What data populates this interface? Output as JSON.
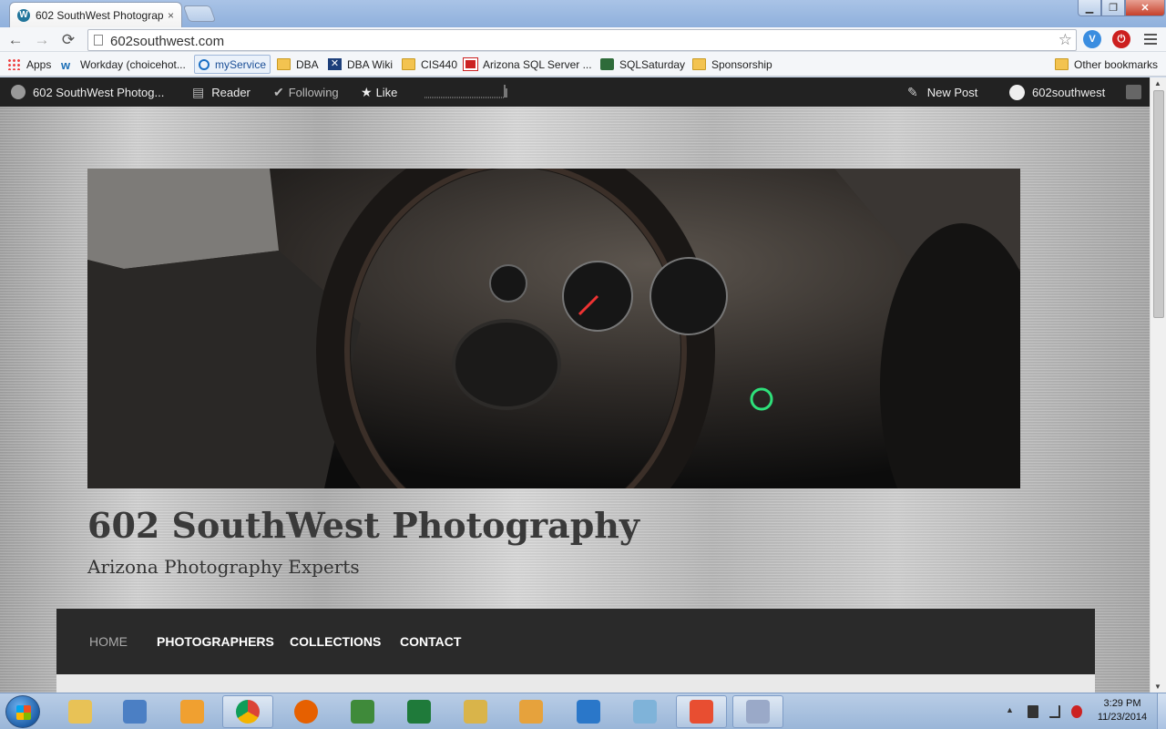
{
  "browser": {
    "tab_title": "602 SouthWest Photograp",
    "tab_close": "×",
    "url": "602southwest.com",
    "window_controls": {
      "minimize": "▁",
      "maximize": "❐",
      "close": "✕"
    },
    "nav": {
      "back": "←",
      "forward": "→",
      "reload": "⟳"
    },
    "star": "☆",
    "extensions": [
      {
        "name": "v-icon",
        "label": "V"
      },
      {
        "name": "stop-icon",
        "label": "⏻"
      }
    ]
  },
  "bookmarks": {
    "items": [
      {
        "label": "Apps",
        "icon": "apps-grid-icon"
      },
      {
        "label": "Workday (choicehot...",
        "icon": "workday-icon"
      },
      {
        "label": "myService",
        "icon": "myservice-icon"
      },
      {
        "label": "DBA",
        "icon": "folder-icon"
      },
      {
        "label": "DBA Wiki",
        "icon": "dba-wiki-icon"
      },
      {
        "label": "CIS440",
        "icon": "folder-icon"
      },
      {
        "label": "Arizona SQL Server ...",
        "icon": "arizona-sql-icon"
      },
      {
        "label": "SQLSaturday",
        "icon": "sqlsaturday-icon"
      },
      {
        "label": "Sponsorship",
        "icon": "folder-icon"
      }
    ],
    "other": "Other bookmarks"
  },
  "adminbar": {
    "site": "602 SouthWest Photog...",
    "reader": "Reader",
    "following": "Following",
    "like": "Like",
    "new_post": "New Post",
    "user": "602southwest"
  },
  "site": {
    "title": "602 SouthWest Photography",
    "tagline": "Arizona Photography Experts",
    "menu": [
      {
        "label": "HOME",
        "current": true
      },
      {
        "label": "PHOTOGRAPHERS",
        "current": false
      },
      {
        "label": "COLLECTIONS",
        "current": false
      },
      {
        "label": "CONTACT",
        "current": false
      }
    ]
  },
  "taskbar": {
    "apps": [
      {
        "name": "explorer-icon",
        "color": "#e8c256"
      },
      {
        "name": "network-icon",
        "color": "#4b7fc4"
      },
      {
        "name": "outlook-icon",
        "color": "#f0a030"
      },
      {
        "name": "chrome-icon",
        "color": "#db4437"
      },
      {
        "name": "firefox-icon",
        "color": "#e66000"
      },
      {
        "name": "security-icon",
        "color": "#3f8a3a"
      },
      {
        "name": "excel-icon",
        "color": "#1f7a3a"
      },
      {
        "name": "tools-icon",
        "color": "#d9b44a"
      },
      {
        "name": "database-icon",
        "color": "#e6a23c"
      },
      {
        "name": "lync-icon",
        "color": "#2a77c9"
      },
      {
        "name": "notes-icon",
        "color": "#7fb3d9"
      },
      {
        "name": "git-icon",
        "color": "#e84e31"
      },
      {
        "name": "paint-icon",
        "color": "#9aa9c8"
      }
    ],
    "clock_time": "3:29 PM",
    "clock_date": "11/23/2014"
  }
}
